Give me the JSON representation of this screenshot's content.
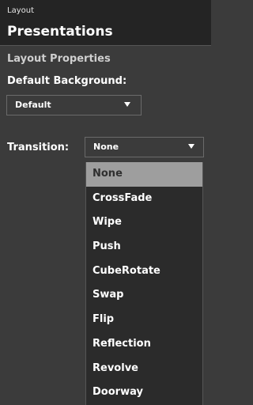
{
  "header": {
    "context_label": "Layout",
    "title": "Presentations"
  },
  "section": {
    "heading": "Layout Properties"
  },
  "background": {
    "label": "Default Background:",
    "value": "Default"
  },
  "transition": {
    "label": "Transition:",
    "value": "None",
    "options": [
      {
        "label": "None",
        "selected": true
      },
      {
        "label": "CrossFade",
        "selected": false
      },
      {
        "label": "Wipe",
        "selected": false
      },
      {
        "label": "Push",
        "selected": false
      },
      {
        "label": "CubeRotate",
        "selected": false
      },
      {
        "label": "Swap",
        "selected": false
      },
      {
        "label": "Flip",
        "selected": false
      },
      {
        "label": "Reflection",
        "selected": false
      },
      {
        "label": "Revolve",
        "selected": false
      },
      {
        "label": "Doorway",
        "selected": false
      }
    ]
  },
  "colors": {
    "panel_bg": "#3b3b3b",
    "header_bg": "#242424",
    "dropdown_bg": "#2b2b2b",
    "selected_bg": "#9e9e9e",
    "text": "#ffffff"
  }
}
